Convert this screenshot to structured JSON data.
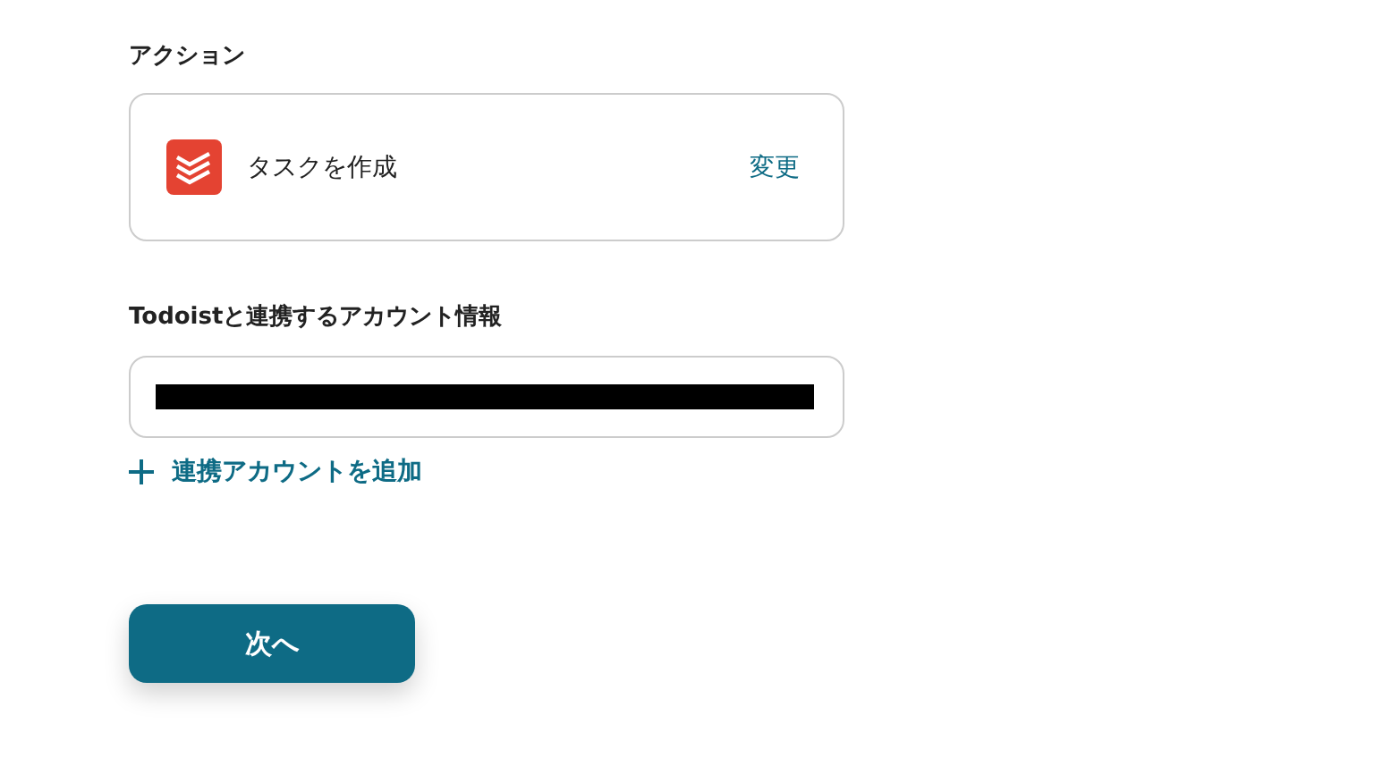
{
  "action": {
    "label": "アクション",
    "name": "タスクを作成",
    "change": "変更"
  },
  "account": {
    "label": "Todoistと連携するアカウント情報",
    "redacted": true,
    "add": "連携アカウントを追加"
  },
  "next_button": "次へ"
}
